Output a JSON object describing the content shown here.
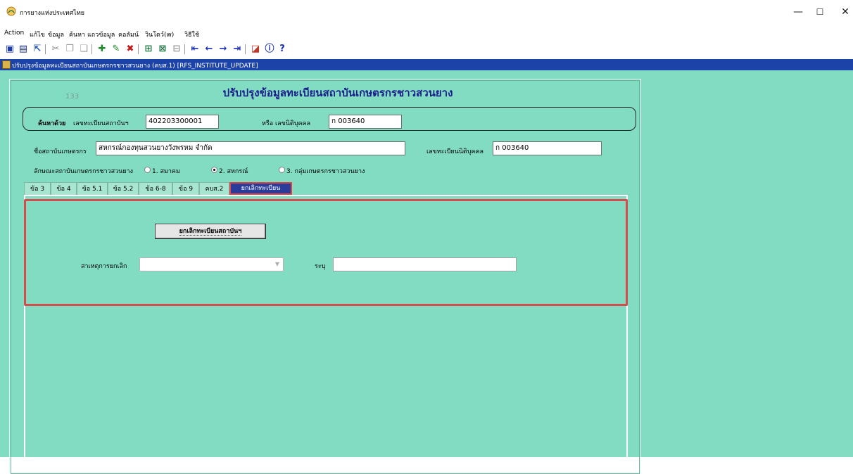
{
  "window": {
    "title": "การยางแห่งประเทศไทย",
    "minimize": "—",
    "maximize": "☐",
    "close": "✕"
  },
  "menu": [
    "Action",
    "แก้ไข",
    "ข้อมูล",
    "ค้นหา",
    "แถวข้อมูล",
    "คอลัมน์",
    "วินโดว์(w)",
    "วิธีใช้"
  ],
  "form": {
    "window_title": "ปรับปรุงข้อมูลทะเบียนสถาบันเกษตรกรชาวสวนยาง (คบส.1) [RFS_INSTITUTE_UPDATE]",
    "record_number": "133",
    "heading": "ปรับปรุงข้อมูลทะเบียนสถาบันเกษตรกรชาวสวนยาง"
  },
  "search": {
    "label": "ค้นหาด้วย",
    "reg_no_label": "เลขทะเบียนสถาบันฯ",
    "reg_no_value": "402203300001",
    "or_juristic_label": "หรือ เลขนิติบุคคล",
    "juristic_value": "ก 003640"
  },
  "details": {
    "name_label": "ชื่อสถาบันเกษตรกร",
    "name_value": "สหกรณ์กองทุนสวนยางวังพรหม จำกัด",
    "juristic_label": "เลขทะเบียนนิติบุคคล",
    "juristic_value": "ก 003640",
    "type_label": "ลักษณะสถาบันเกษตรกรชาวสวนยาง",
    "type_options": [
      "1. สมาคม",
      "2. สหกรณ์",
      "3. กลุ่มเกษตรกรชาวสวนยาง"
    ],
    "type_selected": "2. สหกรณ์"
  },
  "tabs": [
    "ข้อ 3",
    "ข้อ 4",
    "ข้อ 5.1",
    "ข้อ 5.2",
    "ข้อ 6-8",
    "ข้อ 9",
    "คบส.2",
    "ยกเลิกทะเบียน"
  ],
  "active_tab": "ยกเลิกทะเบียน",
  "cancel_panel": {
    "button_label": "ยกเลิกทะเบียนสถาบันฯ",
    "reason_label": "สาเหตุการยกเลิก",
    "reason_value": "",
    "specify_label": "ระบุ",
    "specify_value": ""
  },
  "icons": [
    "save-icon",
    "print-icon",
    "exit-icon",
    "cut-icon",
    "copy-icon",
    "paste-icon",
    "insert-record-icon",
    "edit-record-icon",
    "delete-record-icon",
    "query-icon",
    "execute-query-icon",
    "cancel-query-icon",
    "first-record-icon",
    "previous-record-icon",
    "next-record-icon",
    "last-record-icon",
    "report-icon",
    "info-icon",
    "help-icon"
  ],
  "colors": {
    "workspace": "#82dcc1",
    "form_bar": "#1c44a8",
    "heading": "#1a1e8c",
    "highlight": "#d44c4c",
    "active_tab": "#2a3b9a"
  }
}
